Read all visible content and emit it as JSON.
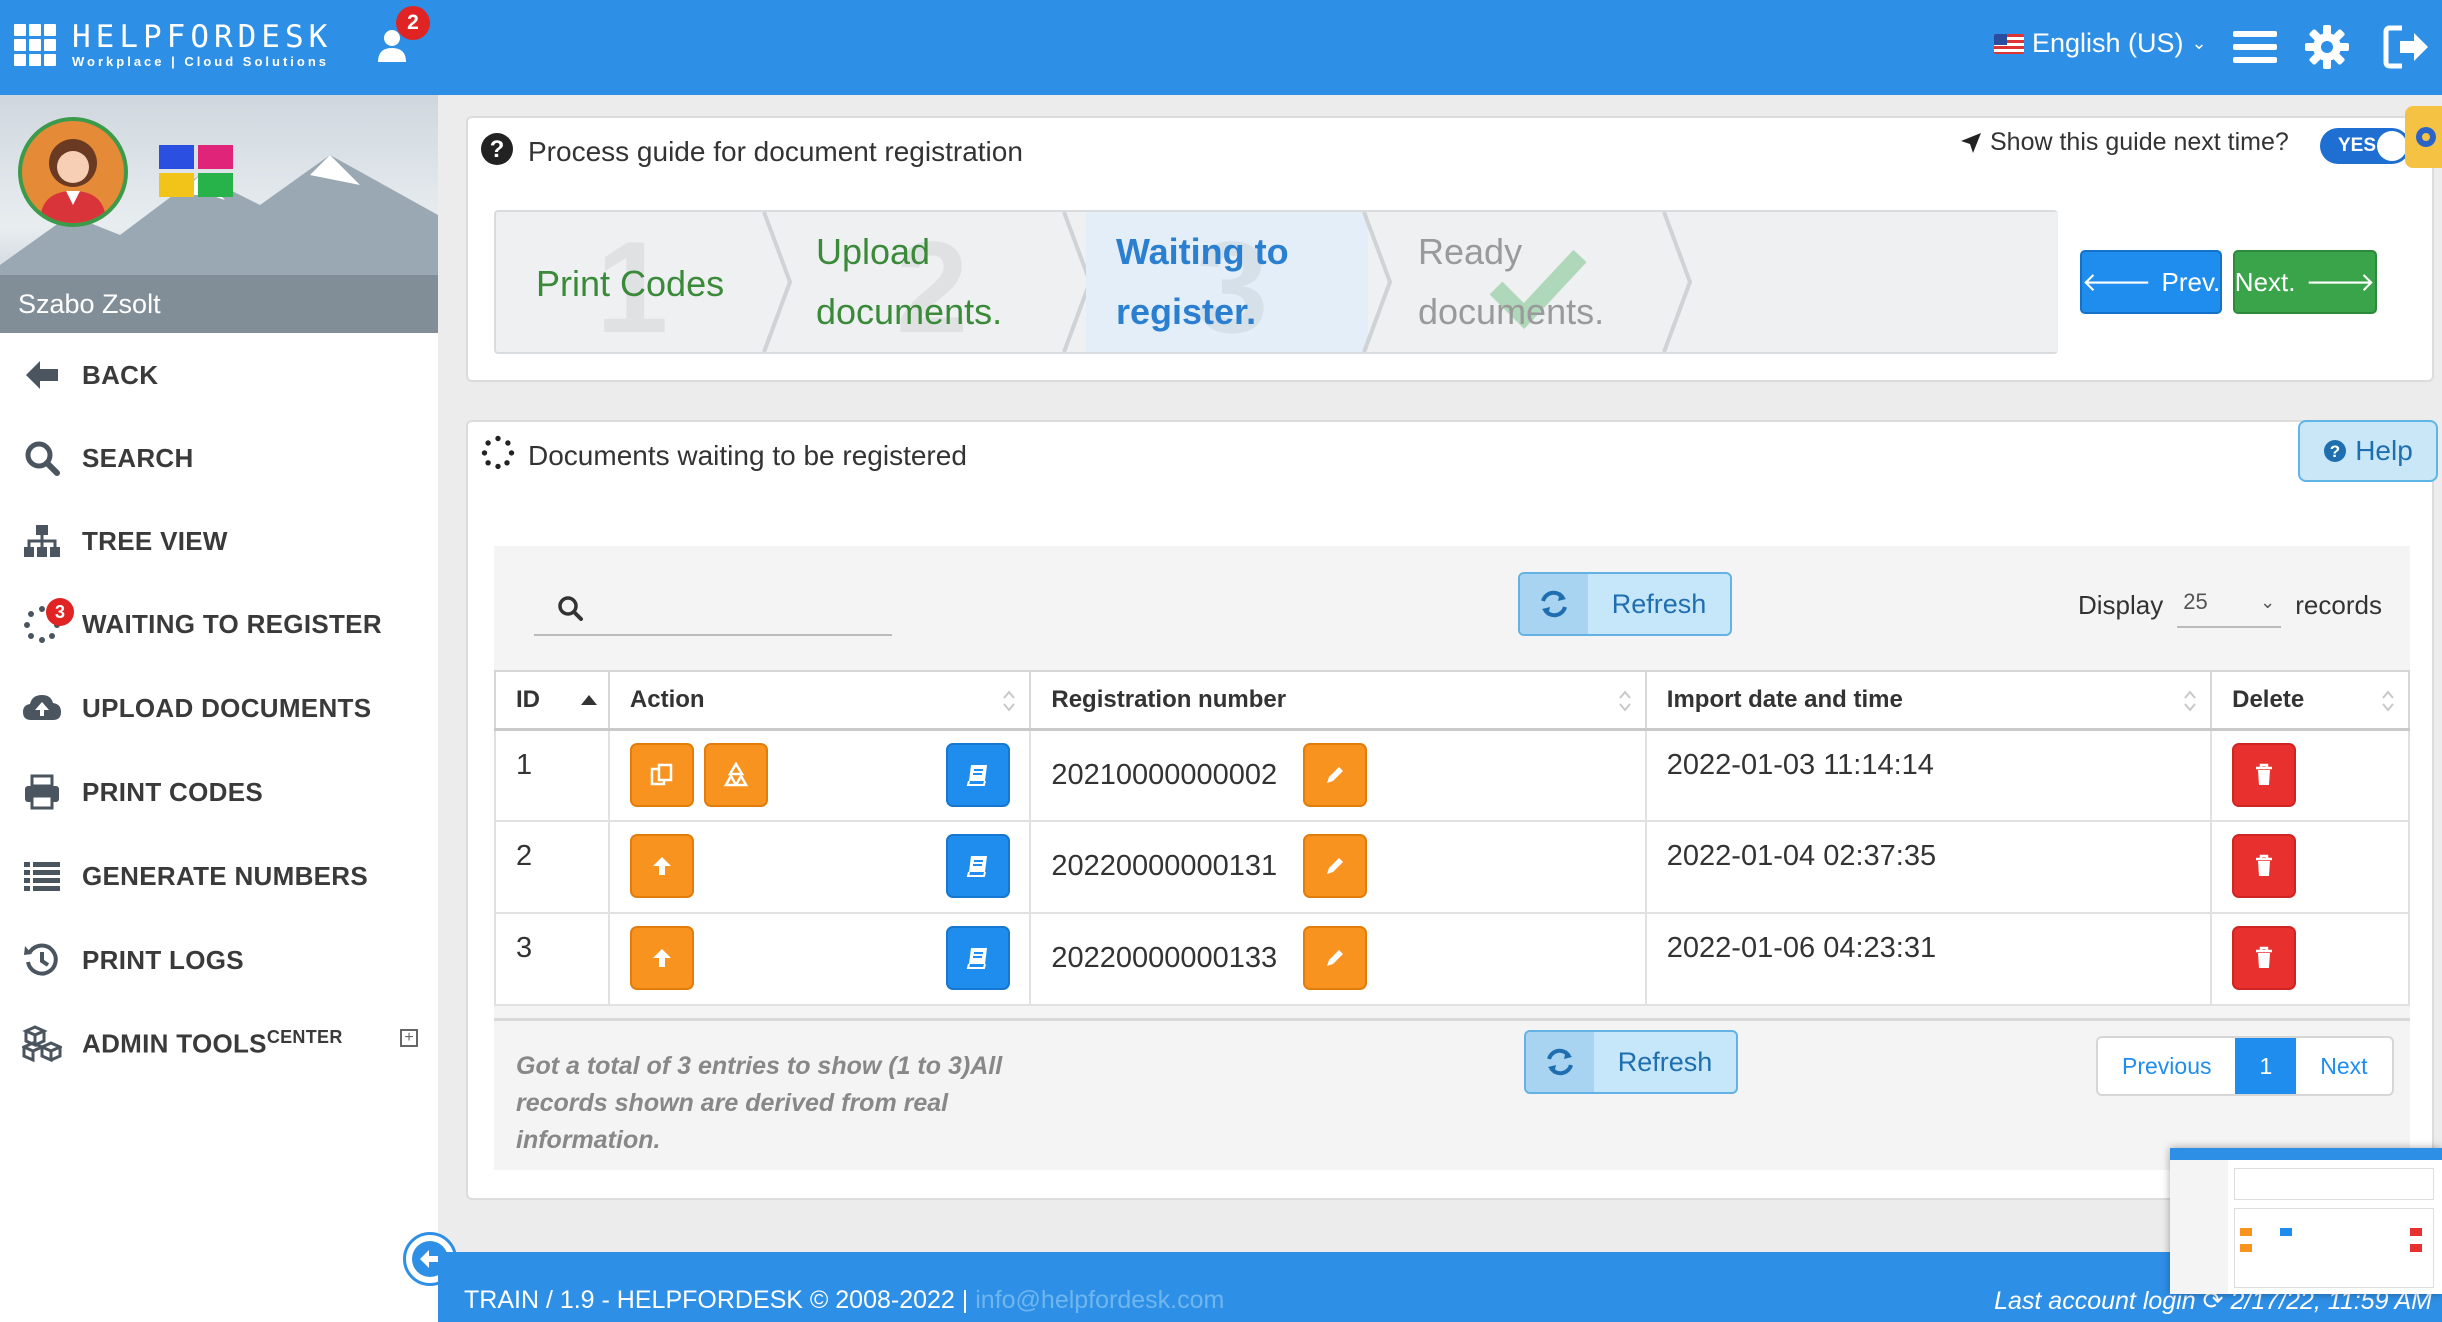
{
  "header": {
    "brand_name": "HELPFORDESK",
    "brand_tagline": "Workplace | Cloud Solutions",
    "notification_count": "2",
    "language": "English (US)"
  },
  "sidebar": {
    "user_name": "Szabo Zsolt",
    "items": [
      {
        "label": "BACK",
        "icon": "arrow-left-icon"
      },
      {
        "label": "SEARCH",
        "icon": "search-icon"
      },
      {
        "label": "TREE VIEW",
        "icon": "sitemap-icon"
      },
      {
        "label": "WAITING TO REGISTER",
        "icon": "spinner-icon",
        "badge": "3"
      },
      {
        "label": "UPLOAD DOCUMENTS",
        "icon": "cloud-upload-icon"
      },
      {
        "label": "PRINT CODES",
        "icon": "printer-icon"
      },
      {
        "label": "GENERATE NUMBERS",
        "icon": "list-icon"
      },
      {
        "label": "PRINT LOGS",
        "icon": "history-icon"
      },
      {
        "label": "ADMIN TOOLS",
        "sup": "CENTER",
        "icon": "cubes-icon"
      }
    ]
  },
  "guide": {
    "title": "Process guide for document registration",
    "toggle_label": "Show this guide next time?",
    "toggle_value": "YES",
    "steps": [
      {
        "num": "1",
        "line1": "Print Codes",
        "line2": "",
        "state": "done"
      },
      {
        "num": "2",
        "line1": "Upload",
        "line2": "documents.",
        "state": "done"
      },
      {
        "num": "3",
        "line1": "Waiting to",
        "line2": "register.",
        "state": "active"
      },
      {
        "num": "✔",
        "line1": "Ready",
        "line2": "documents.",
        "state": "pending"
      }
    ],
    "prev_label": "Prev.",
    "next_label": "Next."
  },
  "docs": {
    "title": "Documents waiting to be registered",
    "help_label": "Help",
    "refresh_label": "Refresh",
    "display_label": "Display",
    "display_value": "25",
    "records_label": "records",
    "columns": [
      "ID",
      "Action",
      "Registration number",
      "Import date and time",
      "Delete"
    ],
    "rows": [
      {
        "id": "1",
        "reg": "20210000000002",
        "date": "2022-01-03 11:14:14"
      },
      {
        "id": "2",
        "reg": "20220000000131",
        "date": "2022-01-04 02:37:35"
      },
      {
        "id": "3",
        "reg": "20220000000133",
        "date": "2022-01-06 04:23:31"
      }
    ],
    "footer_note": "Got a total of 3 entries to show (1 to 3)All records shown are derived from real information.",
    "pager": {
      "previous": "Previous",
      "current": "1",
      "next": "Next"
    }
  },
  "status": {
    "version": "TRAIN / 1.9 - HELPFORDESK © 2008-2022 |",
    "email": "info@helpfordesk.com",
    "last_login": "Last account login ⟳ 2/17/22, 11:59 AM"
  },
  "colors": {
    "primary": "#2e8fe6",
    "success": "#3aa44a",
    "warning": "#f7931e",
    "danger": "#e8312f"
  }
}
